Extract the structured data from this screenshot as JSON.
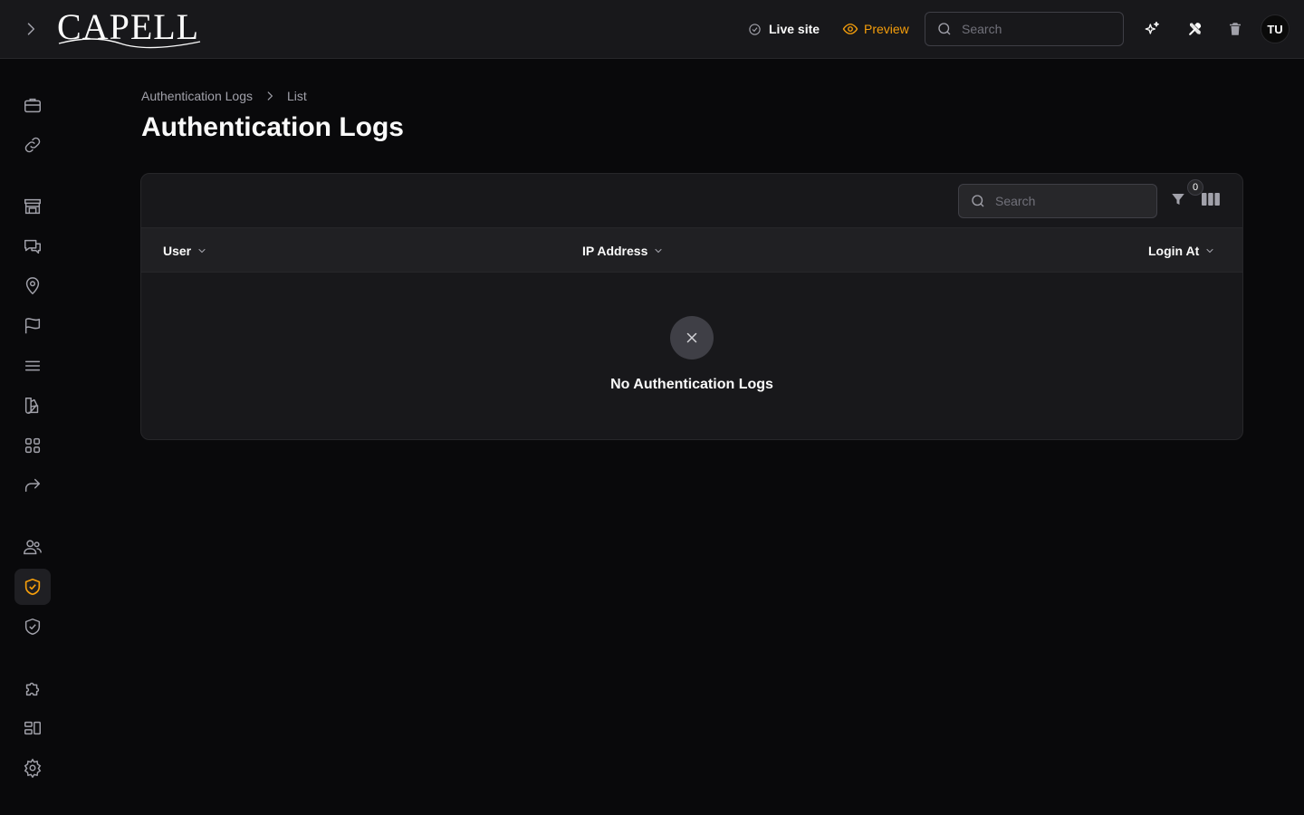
{
  "header": {
    "logo_text": "CAPELL",
    "live_site_label": "Live site",
    "preview_label": "Preview",
    "search_placeholder": "Search",
    "avatar_initials": "TU"
  },
  "sidebar": {
    "items": [
      {
        "icon": "briefcase-icon"
      },
      {
        "icon": "link-icon"
      },
      {
        "icon": "storefront-icon"
      },
      {
        "icon": "chat-bubbles-icon"
      },
      {
        "icon": "map-pin-icon"
      },
      {
        "icon": "flag-icon"
      },
      {
        "icon": "menu-lines-icon"
      },
      {
        "icon": "swatch-icon"
      },
      {
        "icon": "grid-icon"
      },
      {
        "icon": "share-arrow-icon"
      },
      {
        "icon": "users-icon"
      },
      {
        "icon": "shield-check-icon",
        "active": true
      },
      {
        "icon": "shield-check-outline-icon"
      },
      {
        "icon": "puzzle-icon"
      },
      {
        "icon": "layout-blocks-icon"
      },
      {
        "icon": "gear-icon"
      }
    ]
  },
  "breadcrumb": {
    "root": "Authentication Logs",
    "current": "List"
  },
  "page": {
    "title": "Authentication Logs"
  },
  "table": {
    "search_placeholder": "Search",
    "filter_count": "0",
    "columns": [
      "User",
      "IP Address",
      "Login At"
    ],
    "empty_message": "No Authentication Logs"
  },
  "colors": {
    "accent": "#f59e0b",
    "background": "#09090b",
    "panel": "#18181b"
  }
}
